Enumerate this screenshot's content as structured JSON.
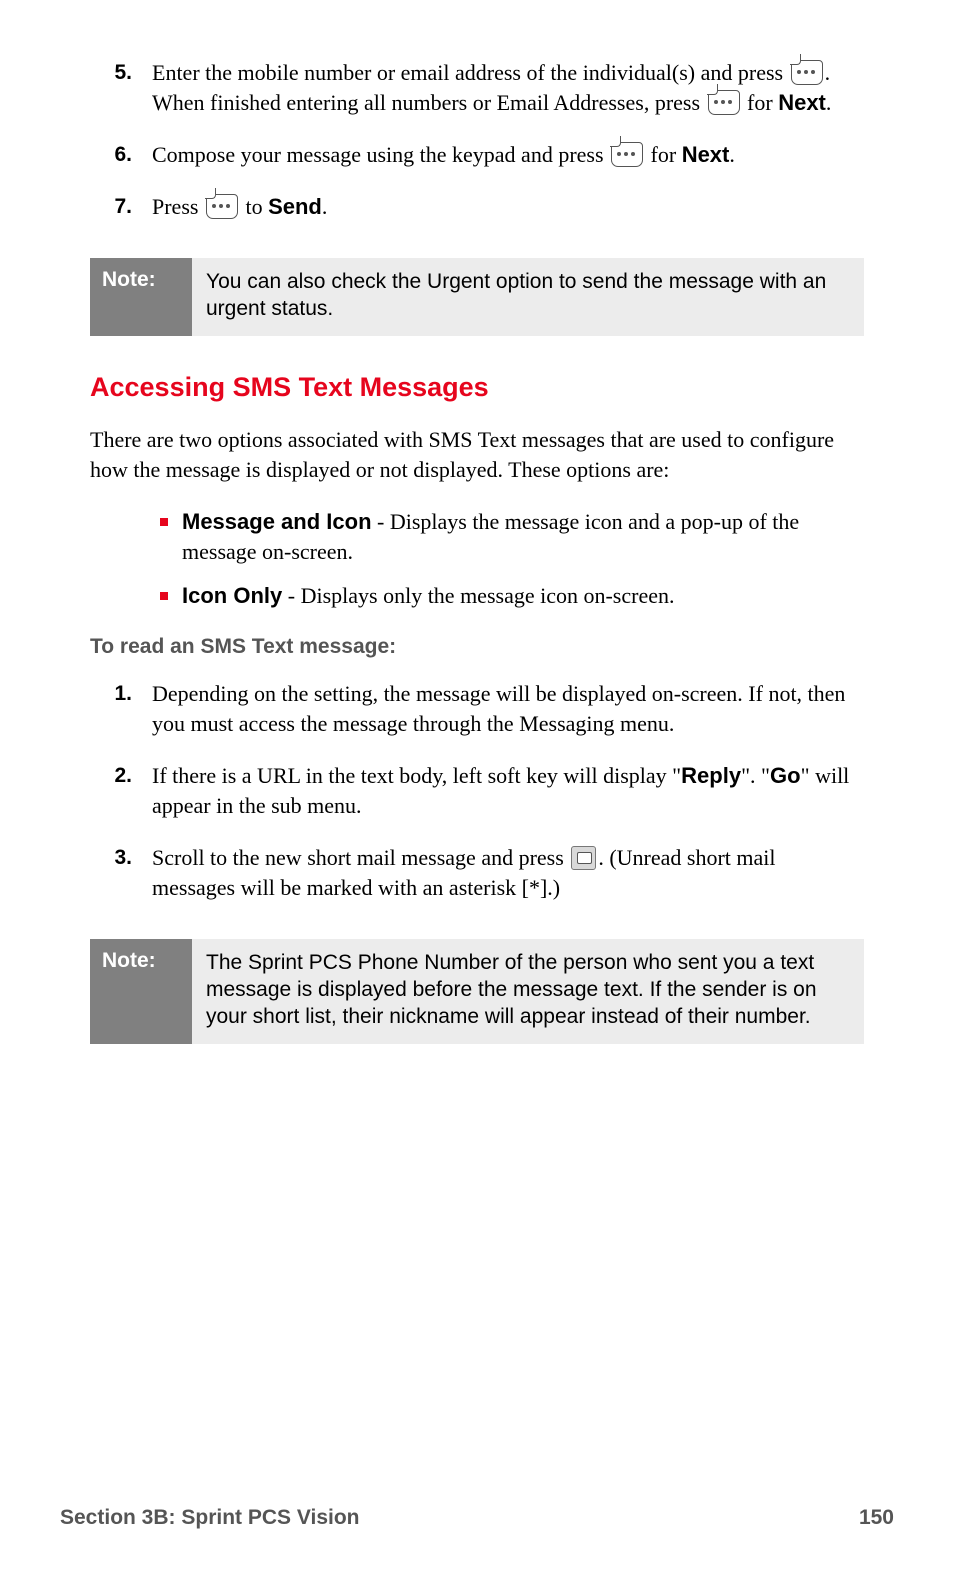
{
  "steps_a": [
    {
      "n": "5.",
      "frags": [
        {
          "t": "Enter the mobile number or email address of the individual(s) and press "
        },
        {
          "icon": "key"
        },
        {
          "t": ". When finished entering all numbers or Email Addresses, press "
        },
        {
          "icon": "key"
        },
        {
          "t": " for "
        },
        {
          "t": "Next",
          "b": true,
          "sans": true
        },
        {
          "t": "."
        }
      ]
    },
    {
      "n": "6.",
      "frags": [
        {
          "t": "Compose your message using the keypad and press "
        },
        {
          "icon": "key"
        },
        {
          "t": " for "
        },
        {
          "t": "Next",
          "b": true,
          "sans": true
        },
        {
          "t": "."
        }
      ]
    },
    {
      "n": "7.",
      "frags": [
        {
          "t": "Press "
        },
        {
          "icon": "key"
        },
        {
          "t": " to "
        },
        {
          "t": "Send",
          "b": true,
          "sans": true
        },
        {
          "t": "."
        }
      ]
    }
  ],
  "note1": {
    "label": "Note:",
    "text": "You can also check the Urgent option to send the message with an urgent status."
  },
  "heading": "Accessing SMS Text Messages",
  "intro": "There are two options associated with SMS Text messages that are used to configure how the message is displayed or not displayed. These options are:",
  "bullets": [
    {
      "frags": [
        {
          "t": "Message and Icon",
          "b": true,
          "sans": true
        },
        {
          "t": " - Displays the message icon and a pop-up of the message on-screen."
        }
      ]
    },
    {
      "frags": [
        {
          "t": "Icon Only",
          "b": true,
          "sans": true
        },
        {
          "t": " - Displays only the message icon on-screen."
        }
      ]
    }
  ],
  "subhead": "To read an SMS Text message:",
  "steps_b": [
    {
      "n": "1.",
      "frags": [
        {
          "t": "Depending on the setting, the message will be displayed on-screen. If not, then you must access the message through the Messaging menu."
        }
      ]
    },
    {
      "n": "2.",
      "frags": [
        {
          "t": "If there is a URL in the text body, left soft key will display \""
        },
        {
          "t": "Reply",
          "b": true,
          "sans": true
        },
        {
          "t": "\".  \""
        },
        {
          "t": "Go",
          "b": true,
          "sans": true
        },
        {
          "t": "\" will appear in the sub menu."
        }
      ]
    },
    {
      "n": "3.",
      "frags": [
        {
          "t": "Scroll to the new short mail message and press "
        },
        {
          "icon": "keySq"
        },
        {
          "t": ". (Unread short mail messages will be marked with an asterisk [*].)"
        }
      ]
    }
  ],
  "note2": {
    "label": "Note:",
    "text": "The Sprint PCS Phone Number of the person who sent you a text message is displayed before the message text. If the sender is on your short list, their nickname will appear instead of their number."
  },
  "footer": {
    "section": "Section 3B: Sprint PCS Vision",
    "page": "150"
  }
}
